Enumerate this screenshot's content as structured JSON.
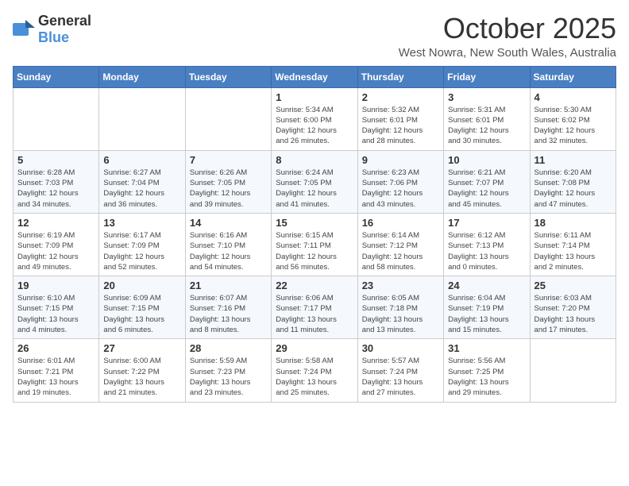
{
  "header": {
    "logo_general": "General",
    "logo_blue": "Blue",
    "month": "October 2025",
    "location": "West Nowra, New South Wales, Australia"
  },
  "weekdays": [
    "Sunday",
    "Monday",
    "Tuesday",
    "Wednesday",
    "Thursday",
    "Friday",
    "Saturday"
  ],
  "weeks": [
    [
      {
        "day": "",
        "info": ""
      },
      {
        "day": "",
        "info": ""
      },
      {
        "day": "",
        "info": ""
      },
      {
        "day": "1",
        "info": "Sunrise: 5:34 AM\nSunset: 6:00 PM\nDaylight: 12 hours\nand 26 minutes."
      },
      {
        "day": "2",
        "info": "Sunrise: 5:32 AM\nSunset: 6:01 PM\nDaylight: 12 hours\nand 28 minutes."
      },
      {
        "day": "3",
        "info": "Sunrise: 5:31 AM\nSunset: 6:01 PM\nDaylight: 12 hours\nand 30 minutes."
      },
      {
        "day": "4",
        "info": "Sunrise: 5:30 AM\nSunset: 6:02 PM\nDaylight: 12 hours\nand 32 minutes."
      }
    ],
    [
      {
        "day": "5",
        "info": "Sunrise: 6:28 AM\nSunset: 7:03 PM\nDaylight: 12 hours\nand 34 minutes."
      },
      {
        "day": "6",
        "info": "Sunrise: 6:27 AM\nSunset: 7:04 PM\nDaylight: 12 hours\nand 36 minutes."
      },
      {
        "day": "7",
        "info": "Sunrise: 6:26 AM\nSunset: 7:05 PM\nDaylight: 12 hours\nand 39 minutes."
      },
      {
        "day": "8",
        "info": "Sunrise: 6:24 AM\nSunset: 7:05 PM\nDaylight: 12 hours\nand 41 minutes."
      },
      {
        "day": "9",
        "info": "Sunrise: 6:23 AM\nSunset: 7:06 PM\nDaylight: 12 hours\nand 43 minutes."
      },
      {
        "day": "10",
        "info": "Sunrise: 6:21 AM\nSunset: 7:07 PM\nDaylight: 12 hours\nand 45 minutes."
      },
      {
        "day": "11",
        "info": "Sunrise: 6:20 AM\nSunset: 7:08 PM\nDaylight: 12 hours\nand 47 minutes."
      }
    ],
    [
      {
        "day": "12",
        "info": "Sunrise: 6:19 AM\nSunset: 7:09 PM\nDaylight: 12 hours\nand 49 minutes."
      },
      {
        "day": "13",
        "info": "Sunrise: 6:17 AM\nSunset: 7:09 PM\nDaylight: 12 hours\nand 52 minutes."
      },
      {
        "day": "14",
        "info": "Sunrise: 6:16 AM\nSunset: 7:10 PM\nDaylight: 12 hours\nand 54 minutes."
      },
      {
        "day": "15",
        "info": "Sunrise: 6:15 AM\nSunset: 7:11 PM\nDaylight: 12 hours\nand 56 minutes."
      },
      {
        "day": "16",
        "info": "Sunrise: 6:14 AM\nSunset: 7:12 PM\nDaylight: 12 hours\nand 58 minutes."
      },
      {
        "day": "17",
        "info": "Sunrise: 6:12 AM\nSunset: 7:13 PM\nDaylight: 13 hours\nand 0 minutes."
      },
      {
        "day": "18",
        "info": "Sunrise: 6:11 AM\nSunset: 7:14 PM\nDaylight: 13 hours\nand 2 minutes."
      }
    ],
    [
      {
        "day": "19",
        "info": "Sunrise: 6:10 AM\nSunset: 7:15 PM\nDaylight: 13 hours\nand 4 minutes."
      },
      {
        "day": "20",
        "info": "Sunrise: 6:09 AM\nSunset: 7:15 PM\nDaylight: 13 hours\nand 6 minutes."
      },
      {
        "day": "21",
        "info": "Sunrise: 6:07 AM\nSunset: 7:16 PM\nDaylight: 13 hours\nand 8 minutes."
      },
      {
        "day": "22",
        "info": "Sunrise: 6:06 AM\nSunset: 7:17 PM\nDaylight: 13 hours\nand 11 minutes."
      },
      {
        "day": "23",
        "info": "Sunrise: 6:05 AM\nSunset: 7:18 PM\nDaylight: 13 hours\nand 13 minutes."
      },
      {
        "day": "24",
        "info": "Sunrise: 6:04 AM\nSunset: 7:19 PM\nDaylight: 13 hours\nand 15 minutes."
      },
      {
        "day": "25",
        "info": "Sunrise: 6:03 AM\nSunset: 7:20 PM\nDaylight: 13 hours\nand 17 minutes."
      }
    ],
    [
      {
        "day": "26",
        "info": "Sunrise: 6:01 AM\nSunset: 7:21 PM\nDaylight: 13 hours\nand 19 minutes."
      },
      {
        "day": "27",
        "info": "Sunrise: 6:00 AM\nSunset: 7:22 PM\nDaylight: 13 hours\nand 21 minutes."
      },
      {
        "day": "28",
        "info": "Sunrise: 5:59 AM\nSunset: 7:23 PM\nDaylight: 13 hours\nand 23 minutes."
      },
      {
        "day": "29",
        "info": "Sunrise: 5:58 AM\nSunset: 7:24 PM\nDaylight: 13 hours\nand 25 minutes."
      },
      {
        "day": "30",
        "info": "Sunrise: 5:57 AM\nSunset: 7:24 PM\nDaylight: 13 hours\nand 27 minutes."
      },
      {
        "day": "31",
        "info": "Sunrise: 5:56 AM\nSunset: 7:25 PM\nDaylight: 13 hours\nand 29 minutes."
      },
      {
        "day": "",
        "info": ""
      }
    ]
  ]
}
